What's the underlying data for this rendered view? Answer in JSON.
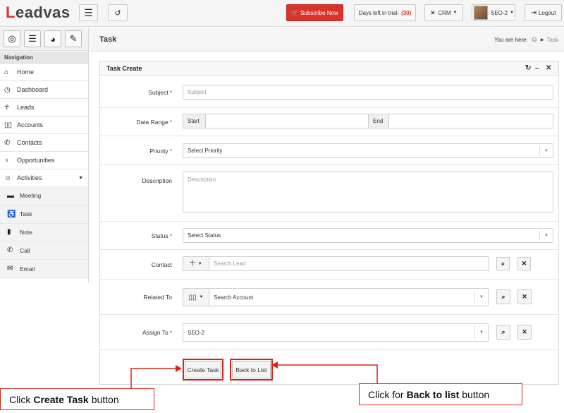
{
  "topbar": {
    "logo_main": "Leadvas",
    "subscribe_label": "Subscribe Now",
    "trial_label": "Days left in trial-",
    "trial_count": "(30)",
    "crm_label": "CRM",
    "user_label": "SEO-2",
    "logout_label": "Logout",
    "menu_icon": "menu-icon",
    "history_icon": "history-icon"
  },
  "sidebar": {
    "icons": [
      "lifebuoy-icon",
      "database-icon",
      "pie-chart-icon",
      "pencil-icon"
    ],
    "nav_title": "Navigation",
    "items": [
      {
        "label": "Home",
        "icon": "home-icon"
      },
      {
        "label": "Dashboard",
        "icon": "dashboard-icon"
      },
      {
        "label": "Leads",
        "icon": "person-icon"
      },
      {
        "label": "Accounts",
        "icon": "book-icon"
      },
      {
        "label": "Contacts",
        "icon": "phone-icon"
      },
      {
        "label": "Opportunities",
        "icon": "pin-icon"
      },
      {
        "label": "Activities",
        "icon": "people-icon"
      }
    ],
    "sub_items": [
      {
        "label": "Meeting",
        "icon": "briefcase-icon"
      },
      {
        "label": "Task",
        "icon": "wheelchair-icon"
      },
      {
        "label": "Note",
        "icon": "notebook-icon"
      },
      {
        "label": "Call",
        "icon": "phone-icon"
      },
      {
        "label": "Email",
        "icon": "envelope-icon"
      }
    ]
  },
  "page": {
    "title": "Task",
    "breadcrumb_prefix": "You are here:",
    "breadcrumb_current": "Task"
  },
  "panel": {
    "title": "Task Create",
    "tools": [
      "refresh-icon",
      "minimize-icon",
      "maximize-icon"
    ]
  },
  "form": {
    "subject_label": "Subject",
    "subject_placeholder": "Subject",
    "date_label": "Date Range",
    "start_label": "Start",
    "end_label": "End",
    "priority_label": "Priority",
    "priority_value": "Select Priority",
    "description_label": "Description",
    "description_placeholder": "Description",
    "status_label": "Status",
    "status_value": "Select Status",
    "contact_label": "Contact",
    "contact_placeholder": "Search Lead",
    "related_label": "Related To",
    "related_value": "Search Account",
    "assign_label": "Assign To",
    "assign_value": "SEO-2",
    "required_mark": "*"
  },
  "actions": {
    "create_label": "Create Task",
    "back_label": "Back to List"
  },
  "annotations": {
    "left_pre": "Click",
    "left_bold": "Create Task",
    "left_post": "button",
    "right_pre": "Click for",
    "right_bold": "Back to list",
    "right_post": "button"
  },
  "colors": {
    "accent_red": "#d9342c",
    "annotation_red": "#d9231c"
  }
}
